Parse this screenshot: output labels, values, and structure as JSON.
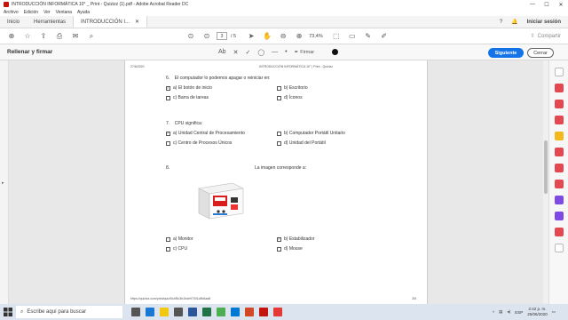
{
  "window": {
    "title": "INTRODUCCIÓN INFORMÁTICA 10° _ Print - Quizizz (1).pdf - Adobe Acrobat Reader DC",
    "controls": [
      "—",
      "☐",
      "✕"
    ]
  },
  "menu": [
    "Archivo",
    "Edición",
    "Ver",
    "Ventana",
    "Ayuda"
  ],
  "tabs": {
    "inicio": "Inicio",
    "herramientas": "Herramientas",
    "document": "INTRODUCCIÓN I...",
    "signin": "Iniciar sesión"
  },
  "toolbar": {
    "page_current": "3",
    "page_total": "/ 5",
    "zoom": "73,4%",
    "share": "Compartir"
  },
  "fill_sign": {
    "title": "Rellenar y firmar",
    "firmar": "Firmar",
    "next": "Siguiente",
    "close": "Cerrar"
  },
  "page": {
    "header_date": "27/6/2020",
    "header_title": "INTRODUCCIÓN INFORMÁTICA 10° | Print - Quizizz",
    "footer_url": "https://quizizz.com/print/quiz/5c4f5c3b1bde97001c8b6aa8",
    "footer_page": "3/5",
    "questions": [
      {
        "number": "6.",
        "text": "El computador lo podemos apagar o reiniciar en:",
        "options": [
          {
            "label": "a) El botón de inicio",
            "checked": true
          },
          {
            "label": "b) Escritorio",
            "checked": false
          },
          {
            "label": "c) Barra de tareas",
            "checked": false
          },
          {
            "label": "d) Íconos",
            "checked": false
          }
        ]
      },
      {
        "number": "7.",
        "text": "CPU significa:",
        "options": [
          {
            "label": "a) Unidad Central de Procesamiento",
            "checked": true
          },
          {
            "label": "b) Computador Portátil Unitario",
            "checked": false
          },
          {
            "label": "c) Centro de Procesos Únicos",
            "checked": false
          },
          {
            "label": "d) Unidad del Portátil",
            "checked": false
          }
        ]
      },
      {
        "number": "8.",
        "text": "La imagen corresponde a:",
        "options": [
          {
            "label": "a) Monitor",
            "checked": false
          },
          {
            "label": "b) Estabilizador",
            "checked": true
          },
          {
            "label": "c) CPU",
            "checked": false
          },
          {
            "label": "d) Mouse",
            "checked": false
          }
        ]
      }
    ]
  },
  "taskbar": {
    "search_placeholder": "Escribe aquí para buscar",
    "time": "2:42 p. m.",
    "date": "25/06/2020",
    "lang": "ESP"
  },
  "colors": {
    "accent": "#1473e6",
    "adobe_red": "#c4140e"
  }
}
